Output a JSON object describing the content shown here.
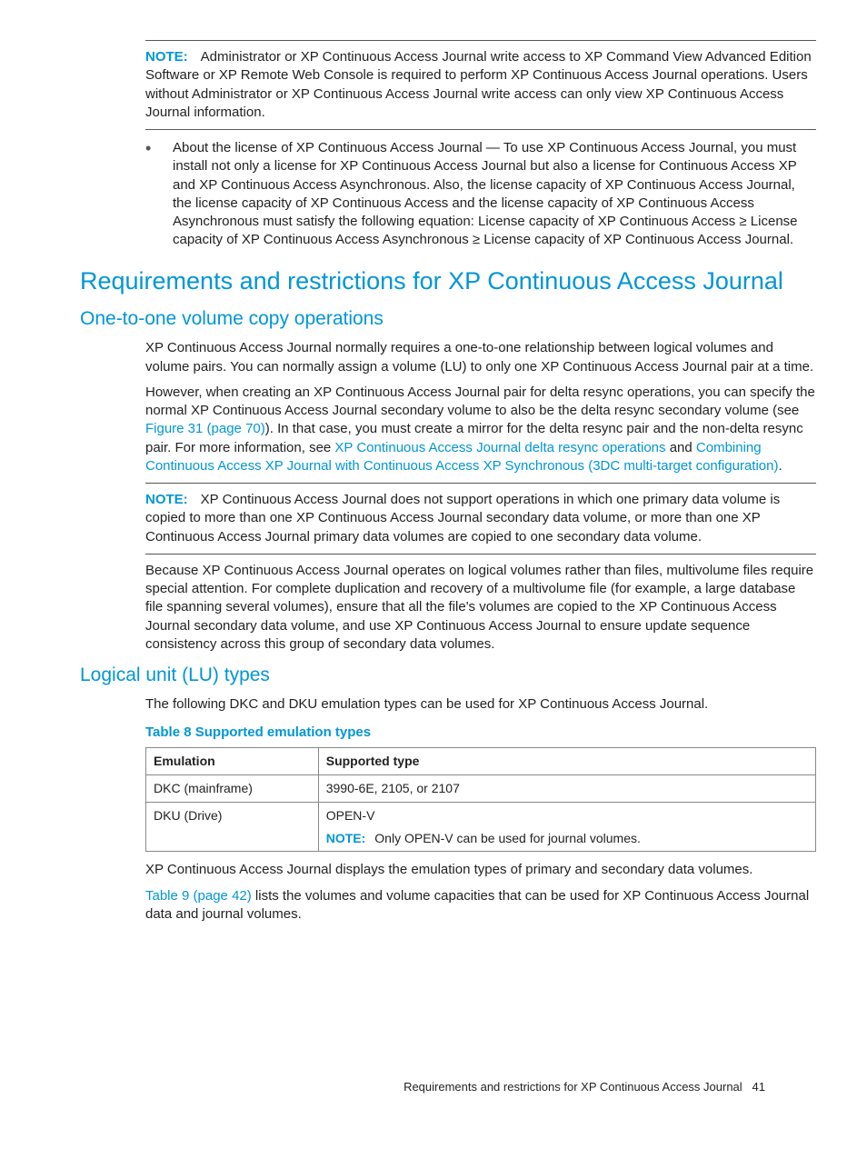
{
  "note1": {
    "label": "NOTE:",
    "text": "Administrator or XP Continuous Access Journal write access to XP Command View Advanced Edition Software or XP Remote Web Console is required to perform XP Continuous Access Journal operations. Users without Administrator or XP Continuous Access Journal write access can only view XP Continuous Access Journal information."
  },
  "bullet1": "About the license of XP Continuous Access Journal — To use XP Continuous Access Journal, you must install not only a license for XP Continuous Access Journal but also a license for Continuous Access XP and XP Continuous Access Asynchronous. Also, the license capacity of XP Continuous Access Journal, the license capacity of XP Continuous Access and the license capacity of XP Continuous Access Asynchronous must satisfy the following equation: License capacity of XP Continuous Access ≥ License capacity of XP Continuous Access Asynchronous ≥ License capacity of XP Continuous Access Journal.",
  "h1": "Requirements and restrictions for XP Continuous Access Journal",
  "h2a": "One-to-one volume copy operations",
  "p1": "XP Continuous Access Journal normally requires a one-to-one relationship between logical volumes and volume pairs. You can normally assign a volume (LU) to only one XP Continuous Access Journal pair at a time.",
  "p2a": "However, when creating an XP Continuous Access Journal pair for delta resync operations, you can specify the normal XP Continuous Access Journal secondary volume to also be the delta resync secondary volume (see ",
  "p2link1": "Figure 31 (page 70)",
  "p2b": "). In that case, you must create a mirror for the delta resync pair and the non-delta resync pair. For more information, see ",
  "p2link2": "XP Continuous Access Journal delta resync operations",
  "p2c": " and ",
  "p2link3": "Combining Continuous Access XP Journal with Continuous Access XP Synchronous (3DC multi-target configuration)",
  "p2d": ".",
  "note2": {
    "label": "NOTE:",
    "text": "XP Continuous Access Journal does not support operations in which one primary data volume is copied to more than one XP Continuous Access Journal secondary data volume, or more than one XP Continuous Access Journal primary data volumes are copied to one secondary data volume."
  },
  "p3": "Because XP Continuous Access Journal operates on logical volumes rather than files, multivolume files require special attention. For complete duplication and recovery of a multivolume file (for example, a large database file spanning several volumes), ensure that all the file's volumes are copied to the XP Continuous Access Journal secondary data volume, and use XP Continuous Access Journal to ensure update sequence consistency across this group of secondary data volumes.",
  "h2b": "Logical unit (LU) types",
  "p4": "The following DKC and DKU emulation types can be used for XP Continuous Access Journal.",
  "table": {
    "title": "Table 8 Supported emulation types",
    "headers": [
      "Emulation",
      "Supported type"
    ],
    "rows": [
      {
        "c0": "DKC (mainframe)",
        "c1": "3990-6E, 2105, or 2107"
      },
      {
        "c0": "DKU (Drive)",
        "c1": "OPEN-V",
        "noteLabel": "NOTE:",
        "noteText": "Only OPEN-V can be used for journal volumes."
      }
    ]
  },
  "p5": "XP Continuous Access Journal displays the emulation types of primary and secondary data volumes.",
  "p6link": "Table 9 (page 42)",
  "p6": " lists the volumes and volume capacities that can be used for XP Continuous Access Journal data and journal volumes.",
  "footer": {
    "title": "Requirements and restrictions for XP Continuous Access Journal",
    "page": "41"
  }
}
